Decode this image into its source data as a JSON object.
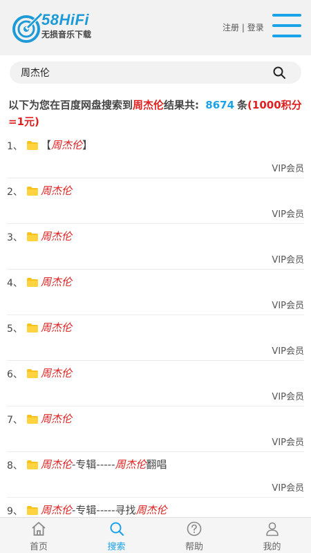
{
  "header": {
    "logo_main": "58HiFi",
    "logo_sub": "无损音乐下载",
    "register_label": "注册",
    "separator": "|",
    "login_label": "登录",
    "accent_color": "#1aa3e8"
  },
  "search": {
    "value": "周杰伦",
    "icon": "search-icon"
  },
  "summary": {
    "prefix": "以下为您在百度网盘搜索到",
    "keyword": "周杰伦",
    "mid": "结果共:",
    "count": "8674",
    "unit": "条",
    "note": "(1000积分=1元)"
  },
  "results": [
    {
      "num": "1、",
      "pre": "【",
      "kw": "周杰伦",
      "mid": "】",
      "kw2": "",
      "post": "",
      "badge": "VIP会员"
    },
    {
      "num": "2、",
      "pre": "",
      "kw": "周杰伦",
      "mid": "",
      "kw2": "",
      "post": "",
      "badge": "VIP会员"
    },
    {
      "num": "3、",
      "pre": "",
      "kw": "周杰伦",
      "mid": "",
      "kw2": "",
      "post": "",
      "badge": "VIP会员"
    },
    {
      "num": "4、",
      "pre": "",
      "kw": "周杰伦",
      "mid": "",
      "kw2": "",
      "post": "",
      "badge": "VIP会员"
    },
    {
      "num": "5、",
      "pre": "",
      "kw": "周杰伦",
      "mid": "",
      "kw2": "",
      "post": "",
      "badge": "VIP会员"
    },
    {
      "num": "6、",
      "pre": "",
      "kw": "周杰伦",
      "mid": "",
      "kw2": "",
      "post": "",
      "badge": "VIP会员"
    },
    {
      "num": "7、",
      "pre": "",
      "kw": "周杰伦",
      "mid": "",
      "kw2": "",
      "post": "",
      "badge": "VIP会员"
    },
    {
      "num": "8、",
      "pre": "",
      "kw": "周杰伦",
      "mid": "-专辑-----",
      "kw2": "周杰伦",
      "post": "翻唱",
      "badge": "VIP会员"
    },
    {
      "num": "9、",
      "pre": "",
      "kw": "周杰伦",
      "mid": "-专辑-----寻找",
      "kw2": "周杰伦",
      "post": "",
      "badge": ""
    }
  ],
  "bottom_nav": [
    {
      "label": "首页",
      "icon": "home-icon",
      "active": false
    },
    {
      "label": "搜索",
      "icon": "search-icon",
      "active": true
    },
    {
      "label": "帮助",
      "icon": "help-icon",
      "active": false
    },
    {
      "label": "我的",
      "icon": "user-icon",
      "active": false
    }
  ]
}
